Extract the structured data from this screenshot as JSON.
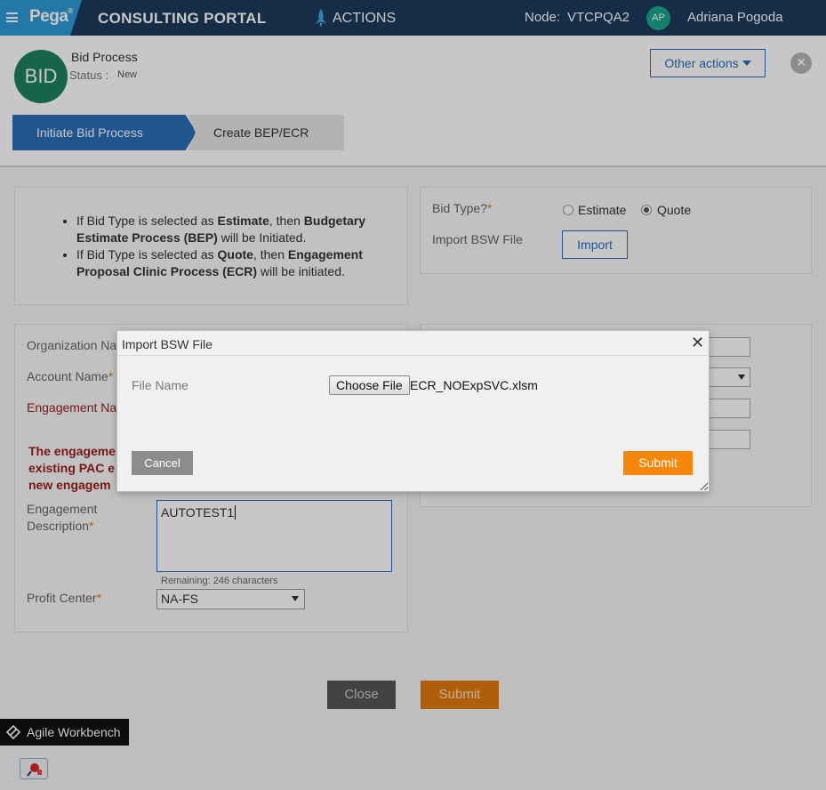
{
  "header": {
    "brand": "Pega",
    "portal_title": "CONSULTING PORTAL",
    "actions_label": "ACTIONS",
    "node_label": "Node:",
    "node_value": "VTCPQA2",
    "user_initials": "AP",
    "user_name": "Adriana Pogoda"
  },
  "case": {
    "avatar_text": "BID",
    "title": "Bid Process",
    "status_label": "Status :",
    "status_value": "New",
    "other_actions_label": "Other actions",
    "stages": [
      {
        "label": "Initiate Bid Process",
        "active": true
      },
      {
        "label": "Create BEP/ECR",
        "active": false
      }
    ]
  },
  "info": {
    "bullet_1": {
      "a": "If Bid Type is selected as ",
      "b": "Estimate",
      "c": ", then ",
      "d": "Budgetary Estimate Process (BEP)",
      "e": " will be Initiated."
    },
    "bullet_2": {
      "a": "If Bid Type is selected as ",
      "b": "Quote",
      "c": ", then ",
      "d": "Engagement Proposal Clinic Process (ECR)",
      "e": " will be initiated."
    }
  },
  "bid_type": {
    "label": "Bid Type?",
    "required_mark": "*",
    "options": [
      "Estimate",
      "Quote"
    ],
    "selected": "Quote",
    "import_label": "Import BSW File",
    "import_button": "Import"
  },
  "form": {
    "org_name_label": "Organization Na",
    "account_name_label": "Account Name",
    "engagement_name_label": "Engagement Na",
    "error_lines": [
      "The engageme",
      "existing PAC e",
      "new engagem"
    ],
    "desc_label_1": "Engagement",
    "desc_label_2": "Description",
    "desc_value": "AUTOTEST1",
    "remaining": "Remaining: 246 characters",
    "profit_center_label": "Profit Center",
    "profit_center_value": "NA-FS"
  },
  "footer": {
    "close_label": "Close",
    "submit_label": "Submit"
  },
  "agile_workbench": "Agile Workbench",
  "modal": {
    "title": "Import BSW File",
    "close_glyph": "✕",
    "file_name_label": "File Name",
    "choose_file_label": "Choose File",
    "selected_file": "ECR_NOExpSVC.xlsm",
    "cancel_label": "Cancel",
    "submit_label": "Submit"
  },
  "colors": {
    "header_bg": "#1b3a5c",
    "brand_blue": "#2d9ad6",
    "accent_blue": "#2a6db5",
    "submit_orange": "#f5870c",
    "error_red": "#9b1c1c"
  }
}
